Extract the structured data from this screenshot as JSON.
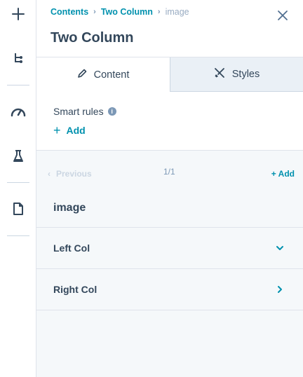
{
  "rail": {
    "items": [
      {
        "name": "add-icon"
      },
      {
        "name": "tree-icon"
      },
      {
        "name": "speedometer-icon"
      },
      {
        "name": "flask-icon"
      },
      {
        "name": "document-icon"
      }
    ]
  },
  "header": {
    "breadcrumb": [
      "Contents",
      "Two Column",
      "image"
    ],
    "title": "Two Column"
  },
  "tabs": [
    {
      "label": "Content",
      "icon": "pencil-icon",
      "active": true
    },
    {
      "label": "Styles",
      "icon": "paint-tools-icon",
      "active": false
    }
  ],
  "smart_rules": {
    "label": "Smart rules",
    "add_label": "Add"
  },
  "pager": {
    "previous_label": "Previous",
    "count": "1/1",
    "add_label": "+ Add",
    "item_name": "image"
  },
  "sections": [
    {
      "label": "Left Col",
      "state": "expanded"
    },
    {
      "label": "Right Col",
      "state": "collapsed"
    }
  ],
  "colors": {
    "accent": "#0091ae",
    "text": "#33475b",
    "muted": "#7c98b6",
    "border": "#dfe3eb",
    "panel_bg": "#f5f8fa"
  }
}
